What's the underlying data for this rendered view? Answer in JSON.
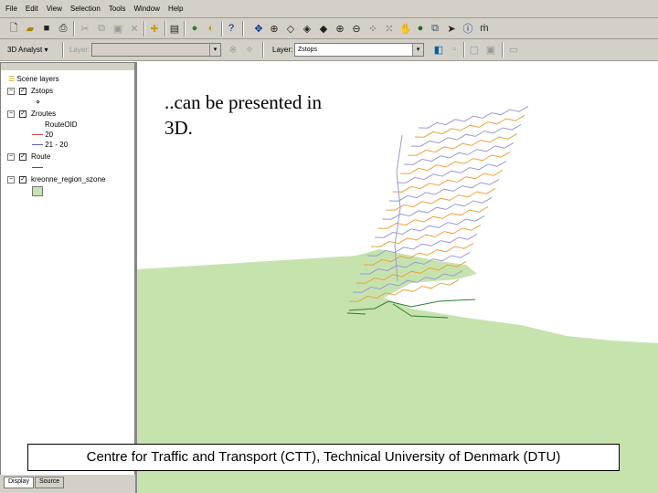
{
  "menu": [
    "File",
    "Edit",
    "View",
    "Selection",
    "Tools",
    "Window",
    "Help"
  ],
  "toolbar2": {
    "analyst_label": "3D Analyst",
    "layer_label": "Layer:",
    "layer_label2": "Layer:",
    "layer_value": "Zstops"
  },
  "toc": {
    "root": "Scene layers",
    "layers": [
      {
        "name": "Zstops"
      },
      {
        "name": "Zroutes",
        "field": "RouteOID",
        "classes": [
          "20",
          "21 - 20"
        ]
      },
      {
        "name": "Route"
      },
      {
        "name": "kreonne_region_szone"
      }
    ]
  },
  "tabs": [
    "Display",
    "Source"
  ],
  "slide": {
    "caption": "..can be presented in 3D.",
    "footer": "Centre for Traffic and Transport (CTT), Technical University of Denmark (DTU)"
  },
  "colors": {
    "land": "#c6e3ae",
    "route": "#2e7d2e",
    "orange": "#f0a040",
    "purple": "#9a9ad8"
  }
}
